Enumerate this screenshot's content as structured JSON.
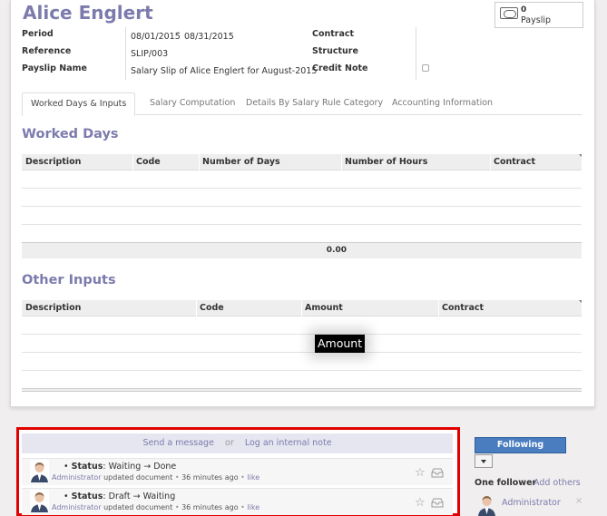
{
  "employee_name": "Alice Englert",
  "smart_button": {
    "count": "0",
    "label": "Payslip"
  },
  "fields": {
    "period_label": "Period",
    "period_from": "08/01/2015",
    "period_sep": "-",
    "period_to": "08/31/2015",
    "reference_label": "Reference",
    "reference_value": "SLIP/003",
    "payslip_name_label": "Payslip Name",
    "payslip_name_value": "Salary Slip of Alice Englert for August-2015",
    "contract_label": "Contract",
    "structure_label": "Structure",
    "credit_note_label": "Credit Note"
  },
  "tabs": [
    {
      "label": "Worked Days & Inputs",
      "active": true
    },
    {
      "label": "Salary Computation"
    },
    {
      "label": "Details By Salary Rule Category"
    },
    {
      "label": "Accounting Information"
    }
  ],
  "worked_days": {
    "title": "Worked Days",
    "columns": [
      "Description",
      "Code",
      "Number of Days",
      "Number of Hours",
      "Contract"
    ],
    "total": "0.00"
  },
  "other_inputs": {
    "title": "Other Inputs",
    "columns": [
      "Description",
      "Code",
      "Amount",
      "Contract"
    ]
  },
  "tooltip": "Amount",
  "chatter": {
    "send_message": "Send a message",
    "or": "or",
    "log_note": "Log an internal note",
    "messages": [
      {
        "bullet": "•",
        "status_label": "Status",
        "status_change": ": Waiting → Done",
        "author": "Administrator",
        "action": "updated document",
        "time": "36 minutes ago",
        "like": "like"
      },
      {
        "bullet": "•",
        "status_label": "Status",
        "status_change": ": Draft → Waiting",
        "author": "Administrator",
        "action": "updated document",
        "time": "36 minutes ago",
        "like": "like"
      }
    ]
  },
  "followers": {
    "follow_button": "Following",
    "title": "One follower",
    "add_others": "Add others",
    "items": [
      {
        "name": "Administrator",
        "remove": "×"
      }
    ]
  },
  "colors": {
    "accent": "#7c7bad",
    "following_button": "#4a7cc0",
    "highlight_border": "#e00000"
  }
}
